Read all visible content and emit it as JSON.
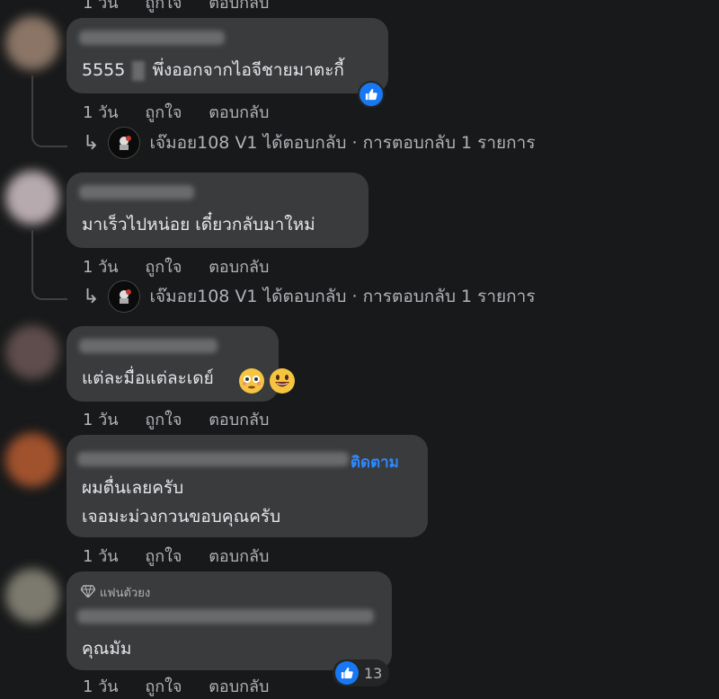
{
  "colors": {
    "bg": "#18191a",
    "bubble": "#3a3b3c",
    "accent": "#2d88ff",
    "like": "#1877f2"
  },
  "actions": {
    "time": "1 วัน",
    "like": "ถูกใจ",
    "reply": "ตอบกลับ"
  },
  "top_meta": {
    "time": "1 วัน",
    "like": "ถูกใจ",
    "reply": "ตอบกลับ"
  },
  "comments": [
    {
      "text": "5555",
      "text2": "พึ่งออกจากไอจีชายมาตะกี้",
      "reactions": {
        "icon": "thumbs-up-icon"
      },
      "reply_summary": {
        "author": "เจ๊มอย108 V1",
        "text": "ได้ตอบกลับ · การตอบกลับ 1 รายการ"
      }
    },
    {
      "text": "มาเร็วไปหน่อย เดี๋ยวกลับมาใหม่",
      "reply_summary": {
        "author": "เจ๊มอย108 V1",
        "text": "ได้ตอบกลับ · การตอบกลับ 1 รายการ"
      }
    },
    {
      "text": "แต่ละมื่อแต่ละเดย์",
      "emojis": [
        "flushed-face-icon",
        "grinning-face-icon"
      ]
    },
    {
      "follow_label": "ติดตาม",
      "line1": "ผมตื่นเลยครับ",
      "line2": "เจอมะม่วงกวนขอบคุณครับ"
    },
    {
      "badge": "แฟนตัวยง",
      "text": "คุณมัม",
      "reactions": {
        "icon": "thumbs-up-icon",
        "count": "13"
      }
    }
  ]
}
